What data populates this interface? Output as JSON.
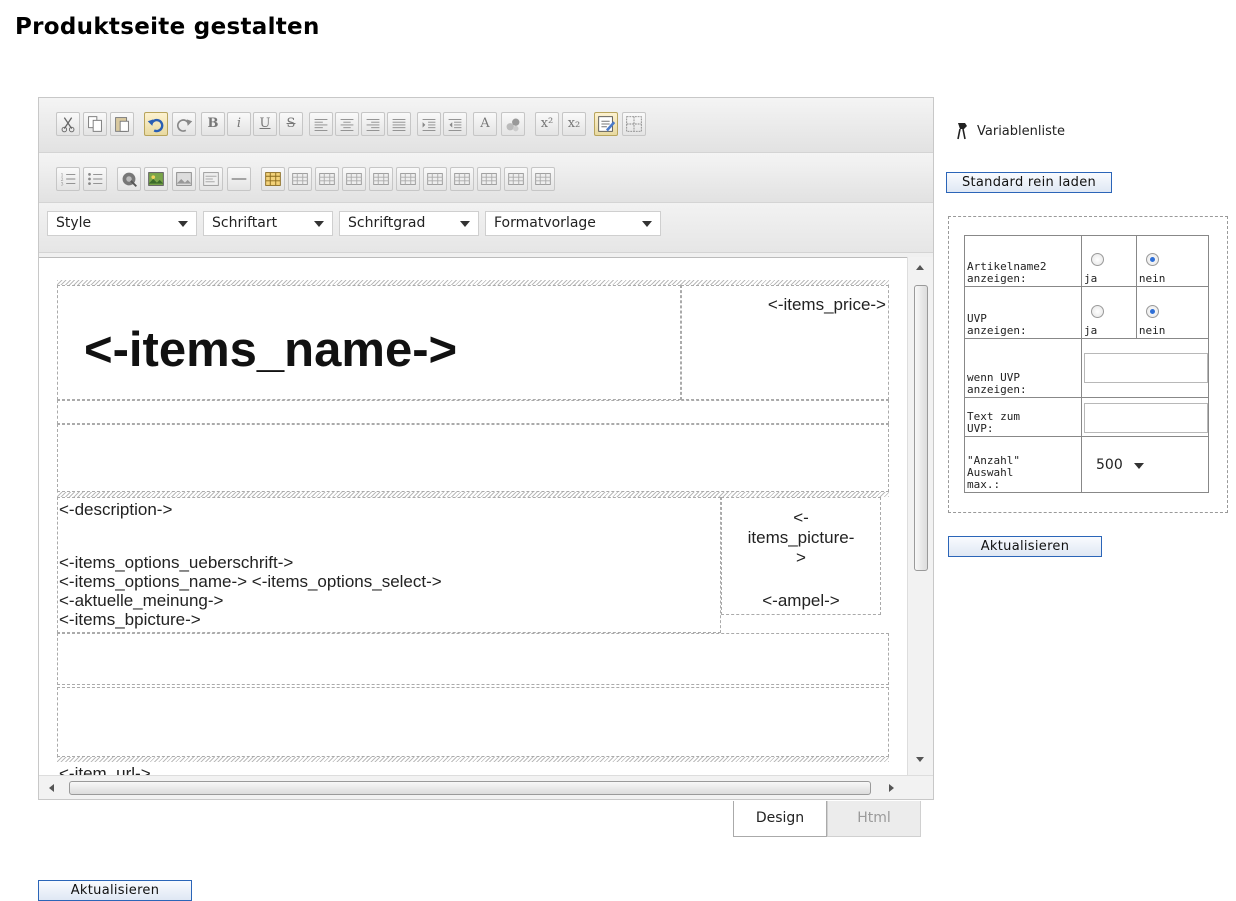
{
  "page": {
    "title": "Produktseite gestalten"
  },
  "toolbar": {
    "row1": [
      "cut-icon",
      "copy-icon",
      "paste-icon",
      "undo-icon",
      "redo-icon",
      "bold-icon",
      "italic-icon",
      "underline-icon",
      "strikethrough-icon",
      "align-left-icon",
      "align-center-icon",
      "align-right-icon",
      "align-justify-icon",
      "indent-icon",
      "outdent-icon",
      "font-color-icon",
      "highlight-icon",
      "superscript-icon",
      "subscript-icon",
      "design-mode-icon",
      "show-borders-icon"
    ],
    "row2": [
      "numbered-list-icon",
      "bullet-list-icon",
      "hyperlink-icon",
      "insert-image-icon",
      "image-map-icon",
      "insert-template-icon",
      "horizontal-rule-icon",
      "insert-table-icon",
      "table-row-above-icon",
      "table-row-below-icon",
      "table-delete-row-icon",
      "table-col-left-icon",
      "table-col-right-icon",
      "table-delete-col-icon",
      "table-merge-icon",
      "table-split-icon",
      "table-cell-props-icon",
      "table-props-icon"
    ],
    "labels": {
      "bold": "B",
      "italic": "i",
      "underline": "U",
      "strike": "S",
      "font_color": "A",
      "superscript": "x²",
      "subscript": "x₂"
    },
    "dropdowns": {
      "style": "Style",
      "font": "Schriftart",
      "size": "Schriftgrad",
      "format": "Formatvorlage"
    }
  },
  "design": {
    "items_name": "<-items_name->",
    "items_price": "<-items_price->",
    "description": "<-description->",
    "options_heading": "<-items_options_ueberschrift->",
    "options_line": "<-items_options_name-> <-items_options_select->",
    "current_opinion": "<-aktuelle_meinung->",
    "bpicture": "<-items_bpicture->",
    "picture_1": "<-",
    "picture_2": "items_picture-",
    "picture_3": ">",
    "ampel": "<-ampel->",
    "item_url": "<-item_url->"
  },
  "tabs": {
    "design": "Design",
    "html": "Html"
  },
  "sidebar": {
    "variable_list": "Variablenliste",
    "load_default": "Standard rein laden",
    "update": "Aktualisieren"
  },
  "settings": {
    "article_name2_label_1": "Artikelname2",
    "article_name2_label_2": "anzeigen:",
    "uvp_label_1": "UVP",
    "uvp_label_2": "anzeigen:",
    "yes": "ja",
    "no": "nein",
    "article_name2_selected": "nein",
    "uvp_selected": "nein",
    "uvp_if_label_1": "wenn UVP",
    "uvp_if_label_2": "anzeigen:",
    "uvp_if_value": "",
    "uvp_text_label_1": "Text zum",
    "uvp_text_label_2": "UVP:",
    "uvp_text_value": "",
    "count_label_1": "\"Anzahl\"",
    "count_label_2": "Auswahl",
    "count_label_3": "max.:",
    "count_value": "500"
  },
  "footer": {
    "update": "Aktualisieren"
  },
  "colors": {
    "button_border": "#2b65b8",
    "radio_selected": "#2f6fd6"
  }
}
